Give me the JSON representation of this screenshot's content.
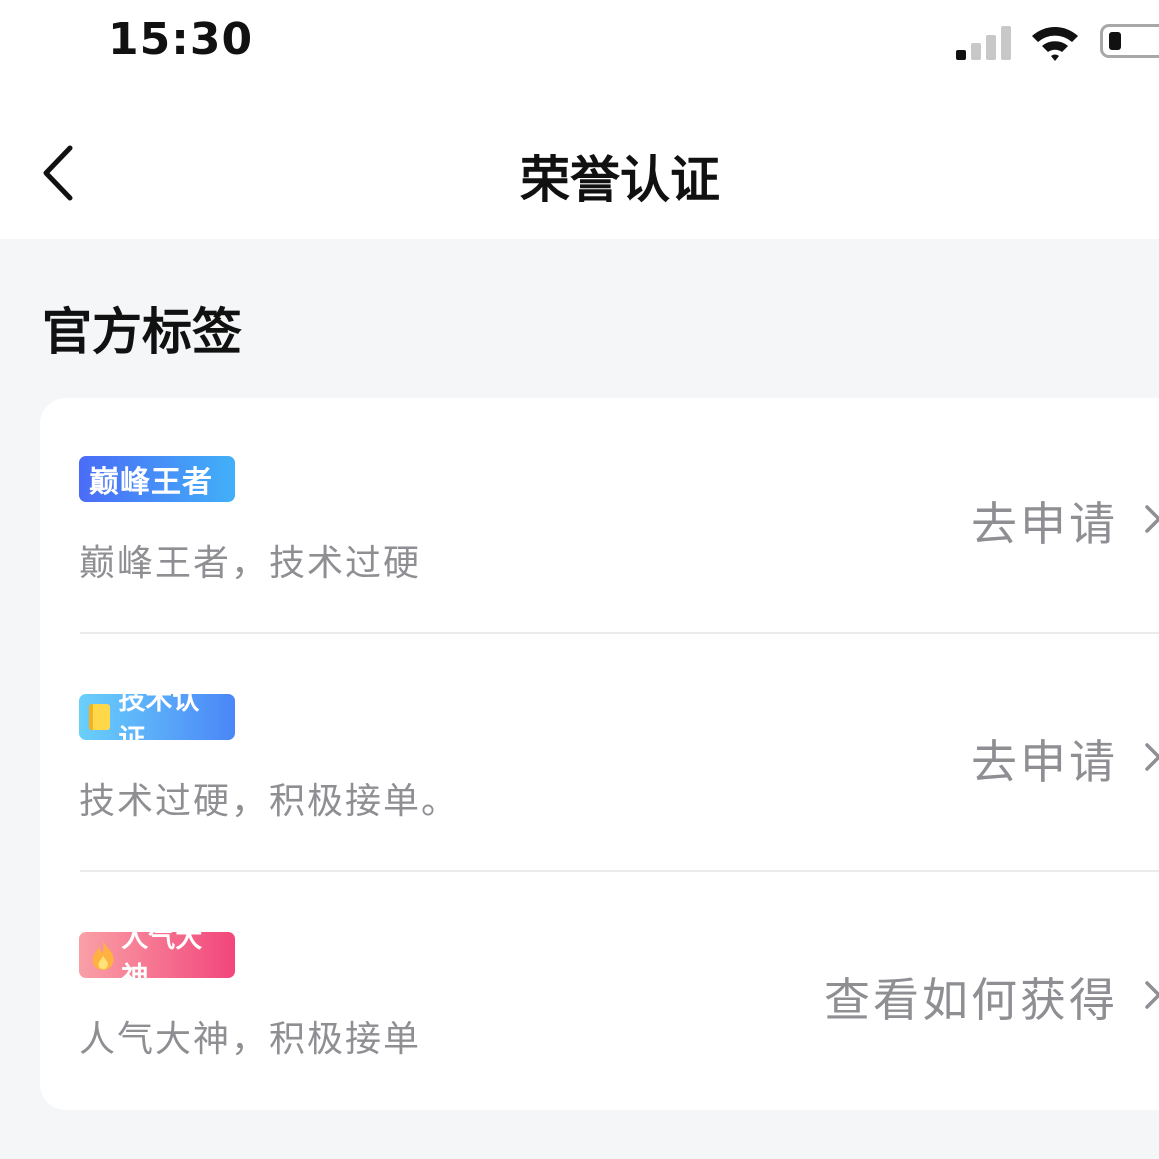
{
  "status_bar": {
    "time": "15:30",
    "battery_level": 0.1
  },
  "nav": {
    "title": "荣誉认证"
  },
  "section": {
    "title": "官方标签"
  },
  "items": [
    {
      "badge": "巅峰王者",
      "badge_icon": "",
      "description": "巅峰王者，技术过硬",
      "action": "去申请"
    },
    {
      "badge": "技术认证",
      "badge_icon": "book-icon",
      "description": "技术过硬，积极接单。",
      "action": "去申请"
    },
    {
      "badge": "人气大神",
      "badge_icon": "flame-icon",
      "description": "人气大神，积极接单",
      "action": "查看如何获得"
    }
  ],
  "colors": {
    "background": "#f4f6f8",
    "card": "#ffffff",
    "secondary_text": "#8e8e93",
    "badge_peak": [
      "#4a6cf7",
      "#42b0f8"
    ],
    "badge_tech": [
      "#6ad0fb",
      "#4a86f7"
    ],
    "badge_pop": [
      "#f9a0a6",
      "#f2467b"
    ]
  }
}
